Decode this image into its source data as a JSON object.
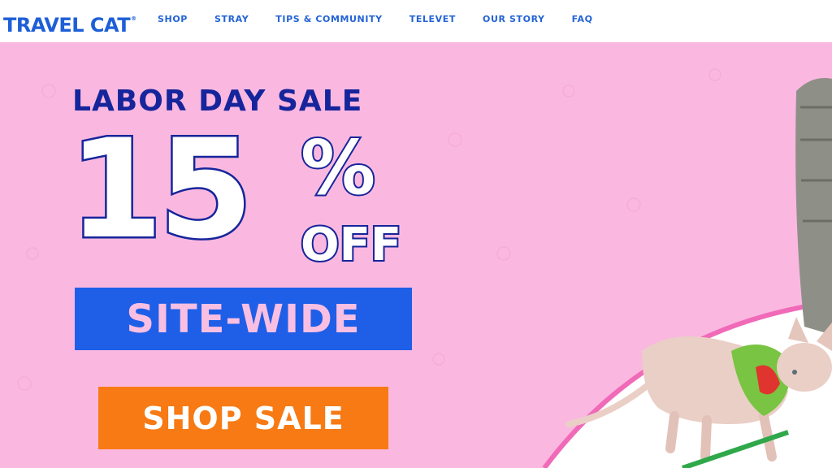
{
  "header": {
    "logo_text": "TRAVEL CAT",
    "logo_mark": "®",
    "nav": [
      {
        "label": "SHOP"
      },
      {
        "label": "STRAY"
      },
      {
        "label": "TIPS & COMMUNITY"
      },
      {
        "label": "TELEVET"
      },
      {
        "label": "OUR STORY"
      },
      {
        "label": "FAQ"
      }
    ]
  },
  "hero": {
    "headline": "LABOR DAY SALE",
    "discount_number": "15",
    "percent_sign": "%",
    "off_text": "OFF",
    "sitewide_text": "SITE-WIDE",
    "cta_label": "SHOP SALE",
    "image_icon": "hairless-cat-with-backpack-image"
  },
  "colors": {
    "brand_blue": "#1d5fd8",
    "navy": "#16259b",
    "hero_pink": "#fab8e0",
    "sitewide_blue": "#1f5fe8",
    "cta_orange": "#f77a14"
  }
}
